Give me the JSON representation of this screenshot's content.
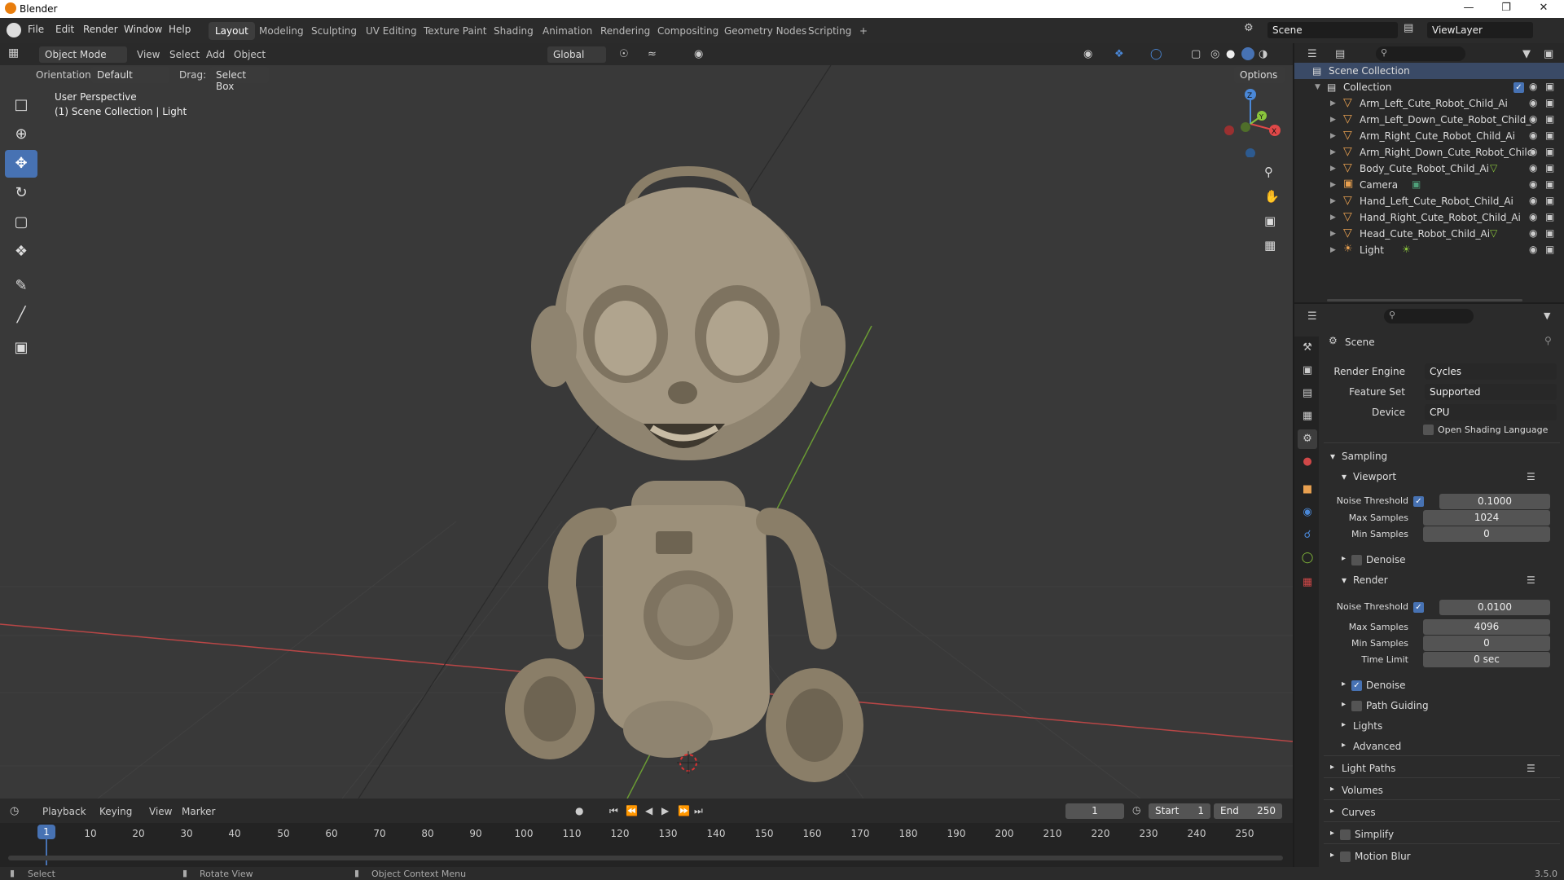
{
  "window": {
    "title": "Blender"
  },
  "menus": [
    "File",
    "Edit",
    "Render",
    "Window",
    "Help"
  ],
  "workspaces": [
    "Layout",
    "Modeling",
    "Sculpting",
    "UV Editing",
    "Texture Paint",
    "Shading",
    "Animation",
    "Rendering",
    "Compositing",
    "Geometry Nodes",
    "Scripting",
    "+"
  ],
  "scene_name": "Scene",
  "view_layer": "ViewLayer",
  "viewport_header": {
    "mode": "Object Mode",
    "view": "View",
    "select": "Select",
    "add": "Add",
    "object": "Object",
    "transform": "Global",
    "options": "Options"
  },
  "viewport_header2": {
    "orientation_label": "Orientation:",
    "orientation_value": "Default",
    "drag_label": "Drag:",
    "drag_value": "Select Box"
  },
  "viewport_overlay": {
    "line1": "User Perspective",
    "line2": "(1) Scene Collection | Light"
  },
  "gizmo": {
    "z": "Z",
    "y": "Y",
    "x": "X"
  },
  "outliner": {
    "root": "Scene Collection",
    "collection": "Collection",
    "items": [
      {
        "name": "Arm_Left_Cute_Robot_Child_Ai",
        "icon": "mesh-icon"
      },
      {
        "name": "Arm_Left_Down_Cute_Robot_Child_",
        "icon": "mesh-icon"
      },
      {
        "name": "Arm_Right_Cute_Robot_Child_Ai",
        "icon": "mesh-icon"
      },
      {
        "name": "Arm_Right_Down_Cute_Robot_Chilc",
        "icon": "mesh-icon"
      },
      {
        "name": "Body_Cute_Robot_Child_Ai",
        "icon": "mesh-icon"
      },
      {
        "name": "Camera",
        "icon": "camera-icon"
      },
      {
        "name": "Hand_Left_Cute_Robot_Child_Ai",
        "icon": "mesh-icon"
      },
      {
        "name": "Hand_Right_Cute_Robot_Child_Ai",
        "icon": "mesh-icon"
      },
      {
        "name": "Head_Cute_Robot_Child_Ai",
        "icon": "mesh-icon"
      },
      {
        "name": "Light",
        "icon": "light-icon"
      }
    ]
  },
  "properties": {
    "context": "Scene",
    "render_engine_label": "Render Engine",
    "render_engine": "Cycles",
    "feature_set_label": "Feature Set",
    "feature_set": "Supported",
    "device_label": "Device",
    "device": "CPU",
    "osl_label": "Open Shading Language",
    "sampling": "Sampling",
    "viewport": "Viewport",
    "noise_threshold_label": "Noise Threshold",
    "viewport_noise": "0.1000",
    "max_samples_label": "Max Samples",
    "viewport_max": "1024",
    "min_samples_label": "Min Samples",
    "viewport_min": "0",
    "denoise_label": "Denoise",
    "render": "Render",
    "render_noise": "0.0100",
    "render_max": "4096",
    "render_min": "0",
    "time_limit_label": "Time Limit",
    "time_limit": "0 sec",
    "path_guiding": "Path Guiding",
    "lights": "Lights",
    "advanced": "Advanced",
    "light_paths": "Light Paths",
    "volumes": "Volumes",
    "curves": "Curves",
    "simplify": "Simplify",
    "motion_blur": "Motion Blur"
  },
  "timeline": {
    "playback": "Playback",
    "keying": "Keying",
    "view": "View",
    "marker": "Marker",
    "current_frame": "1",
    "start_label": "Start",
    "start": "1",
    "end_label": "End",
    "end": "250",
    "ticks": [
      "1",
      "10",
      "20",
      "30",
      "40",
      "50",
      "60",
      "70",
      "80",
      "90",
      "100",
      "110",
      "120",
      "130",
      "140",
      "150",
      "160",
      "170",
      "180",
      "190",
      "200",
      "210",
      "220",
      "230",
      "240",
      "250"
    ]
  },
  "statusbar": {
    "select": "Select",
    "rotate": "Rotate View",
    "context": "Object Context Menu",
    "version": "3.5.0"
  },
  "colors": {
    "accent": "#4772b3",
    "x_axis": "#e04848",
    "y_axis": "#8ac43c",
    "z_axis": "#4a88d8",
    "robot": "#a89a80"
  }
}
